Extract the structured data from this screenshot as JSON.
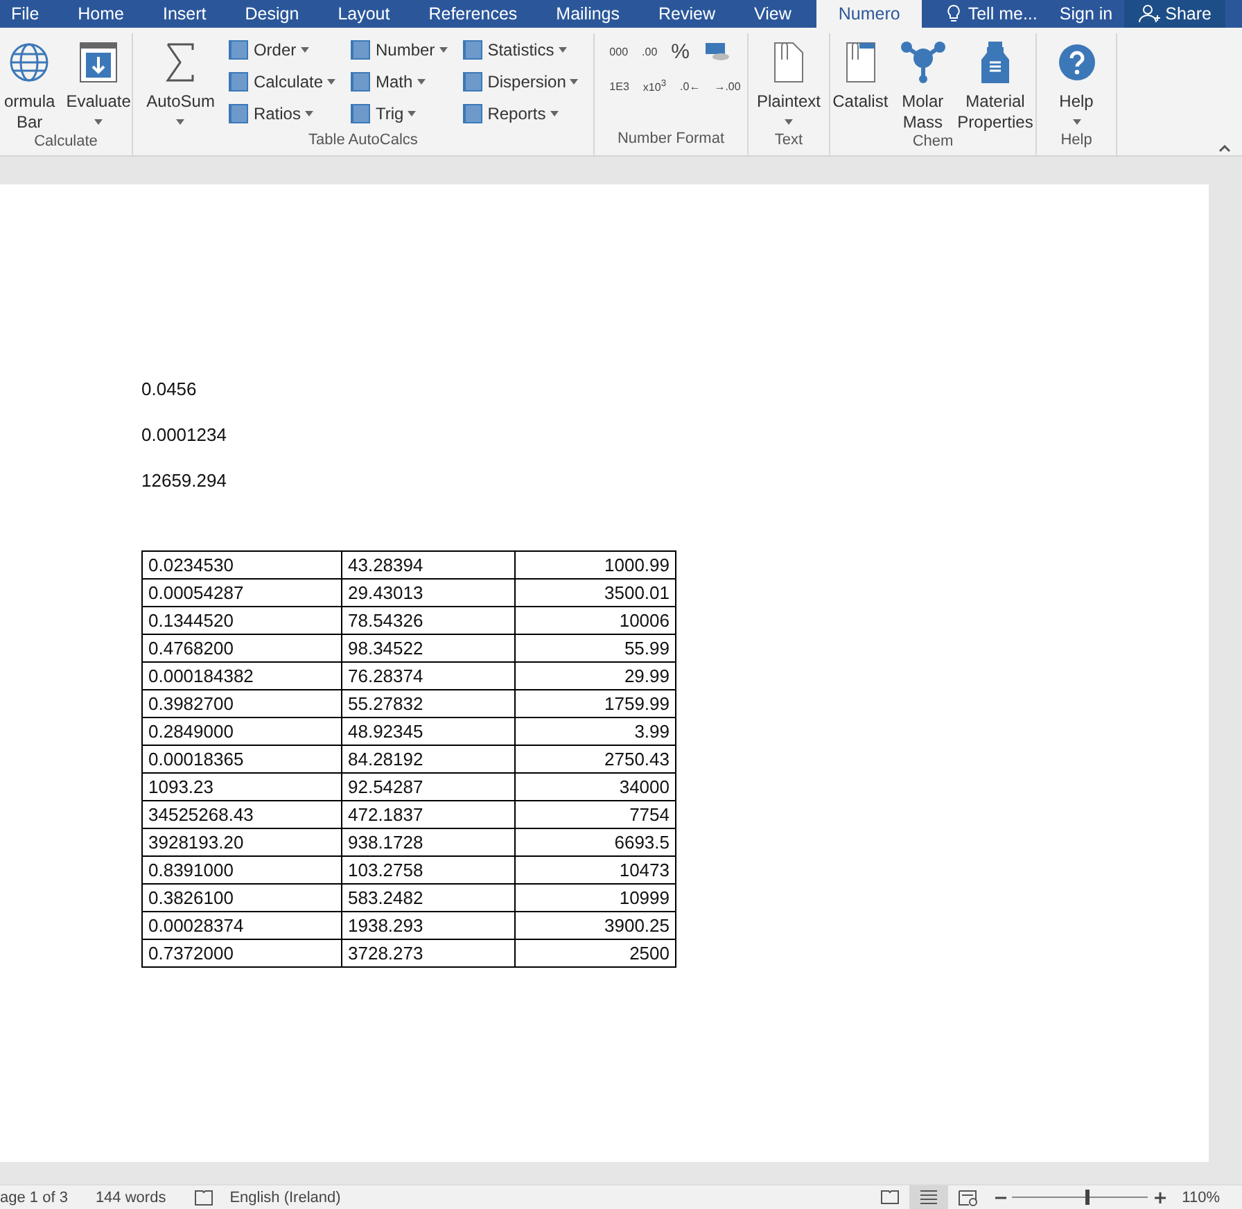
{
  "tabs": [
    {
      "label": "File",
      "selected": false
    },
    {
      "label": "Home",
      "selected": false
    },
    {
      "label": "Insert",
      "selected": false
    },
    {
      "label": "Design",
      "selected": false
    },
    {
      "label": "Layout",
      "selected": false
    },
    {
      "label": "References",
      "selected": false
    },
    {
      "label": "Mailings",
      "selected": false
    },
    {
      "label": "Review",
      "selected": false
    },
    {
      "label": "View",
      "selected": false
    },
    {
      "label": "Numero",
      "selected": true
    }
  ],
  "tell_me": "Tell me...",
  "sign_in": "Sign in",
  "share": "Share",
  "ribbon": {
    "groups": [
      {
        "label": "Calculate",
        "items": [
          {
            "kind": "large",
            "lines": [
              "ormula",
              "Bar"
            ],
            "dropdown": false
          },
          {
            "kind": "large",
            "lines": [
              "Evaluate"
            ],
            "dropdown": true
          }
        ]
      },
      {
        "label": "Table AutoCalcs",
        "items": [
          {
            "kind": "large",
            "lines": [
              "AutoSum"
            ],
            "dropdown": true
          },
          {
            "kind": "column",
            "buttons": [
              "Order",
              "Calculate",
              "Ratios"
            ]
          },
          {
            "kind": "column",
            "buttons": [
              "Number",
              "Math",
              "Trig"
            ]
          },
          {
            "kind": "column",
            "buttons": [
              "Statistics",
              "Dispersion",
              "Reports"
            ]
          }
        ]
      },
      {
        "label": "Number Format",
        "items": [
          {
            "kind": "format",
            "rows": [
              [
                "000",
                ".00",
                "%"
              ],
              [
                "1E3",
                "x10$^{3}$",
                ".0←",
                "→.00"
              ]
            ]
          }
        ]
      },
      {
        "label": "Text",
        "items": [
          {
            "kind": "large",
            "lines": [
              "Plaintext"
            ],
            "dropdown": true
          }
        ]
      },
      {
        "label": "Chem",
        "items": [
          {
            "kind": "large",
            "lines": [
              "Catalist"
            ],
            "dropdown": false
          },
          {
            "kind": "large",
            "lines": [
              "Molar",
              "Mass"
            ],
            "dropdown": false
          },
          {
            "kind": "large",
            "lines": [
              "Material",
              "Properties"
            ],
            "dropdown": false
          }
        ]
      },
      {
        "label": "Help",
        "items": [
          {
            "kind": "large",
            "lines": [
              "Help"
            ],
            "dropdown": true
          }
        ]
      }
    ]
  },
  "document": {
    "paragraphs": [
      "0.0456",
      "0.0001234",
      "12659.294"
    ],
    "table": {
      "rows": [
        [
          "0.0234530",
          "43.28394",
          "1000.99"
        ],
        [
          "0.00054287",
          "29.43013",
          "3500.01"
        ],
        [
          "0.1344520",
          "78.54326",
          "10006"
        ],
        [
          "0.4768200",
          "98.34522",
          "55.99"
        ],
        [
          "0.000184382",
          "76.28374",
          "29.99"
        ],
        [
          "0.3982700",
          "55.27832",
          "1759.99"
        ],
        [
          "0.2849000",
          "48.92345",
          "3.99"
        ],
        [
          "0.00018365",
          "84.28192",
          "2750.43"
        ],
        [
          "1093.23",
          "92.54287",
          "34000"
        ],
        [
          "34525268.43",
          "472.1837",
          "7754"
        ],
        [
          "3928193.20",
          "938.1728",
          "6693.5"
        ],
        [
          "0.8391000",
          "103.2758",
          "10473"
        ],
        [
          "0.3826100",
          "583.2482",
          "10999"
        ],
        [
          "0.00028374",
          "1938.293",
          "3900.25"
        ],
        [
          "0.7372000",
          "3728.273",
          "2500"
        ]
      ]
    }
  },
  "status_bar": {
    "page": "age 1 of 3",
    "words": "144 words",
    "language": "English (Ireland)",
    "zoom": {
      "level": 0.54,
      "reading": "110%"
    }
  }
}
